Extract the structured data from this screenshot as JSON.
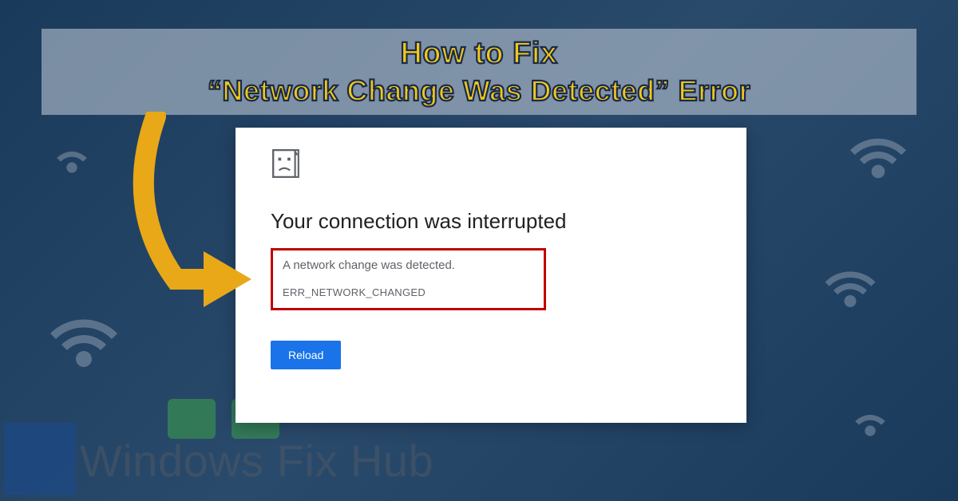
{
  "header": {
    "line1": "How to Fix",
    "line2": "“Network Change Was Detected” Error"
  },
  "error_window": {
    "heading": "Your connection was interrupted",
    "subtext": "A network change was detected.",
    "error_code": "ERR_NETWORK_CHANGED",
    "reload_label": "Reload"
  },
  "watermark": {
    "text": "Windows Fix Hub"
  }
}
